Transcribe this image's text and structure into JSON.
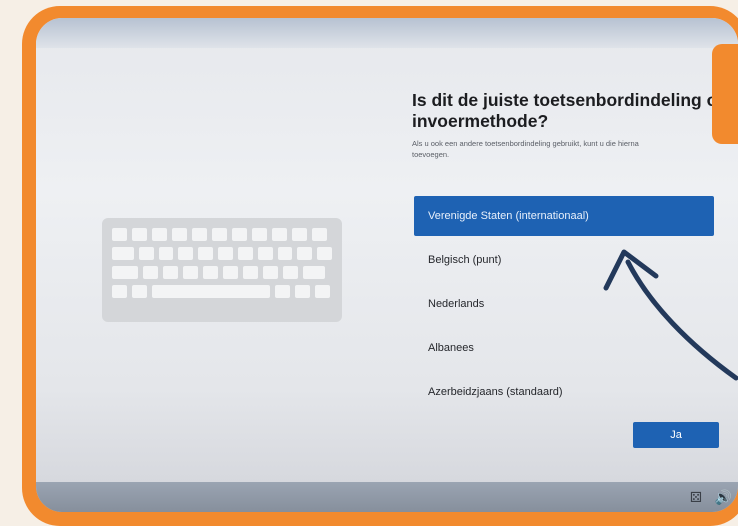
{
  "setup": {
    "heading": "Is dit de juiste toetsenbordindeling of invoermethode?",
    "subtext_line1": "Als u ook een andere toetsenbordindeling gebruikt, kunt u die hierna",
    "subtext_line2": "toevoegen.",
    "layouts": [
      {
        "label": "Verenigde Staten (internationaal)",
        "selected": true
      },
      {
        "label": "Belgisch (punt)",
        "selected": false
      },
      {
        "label": "Nederlands",
        "selected": false
      },
      {
        "label": "Albanees",
        "selected": false
      },
      {
        "label": "Azerbeidzjaans (standaard)",
        "selected": false
      }
    ],
    "next_button_label": "Ja"
  },
  "colors": {
    "accent": "#1e62b3",
    "frame": "#f28a2e",
    "annotation_arrow": "#23395b"
  },
  "icons": {
    "keyboard": "keyboard-illustration",
    "accessibility": "accessibility-icon",
    "volume": "volume-icon",
    "annotation": "curved-arrow-icon"
  }
}
